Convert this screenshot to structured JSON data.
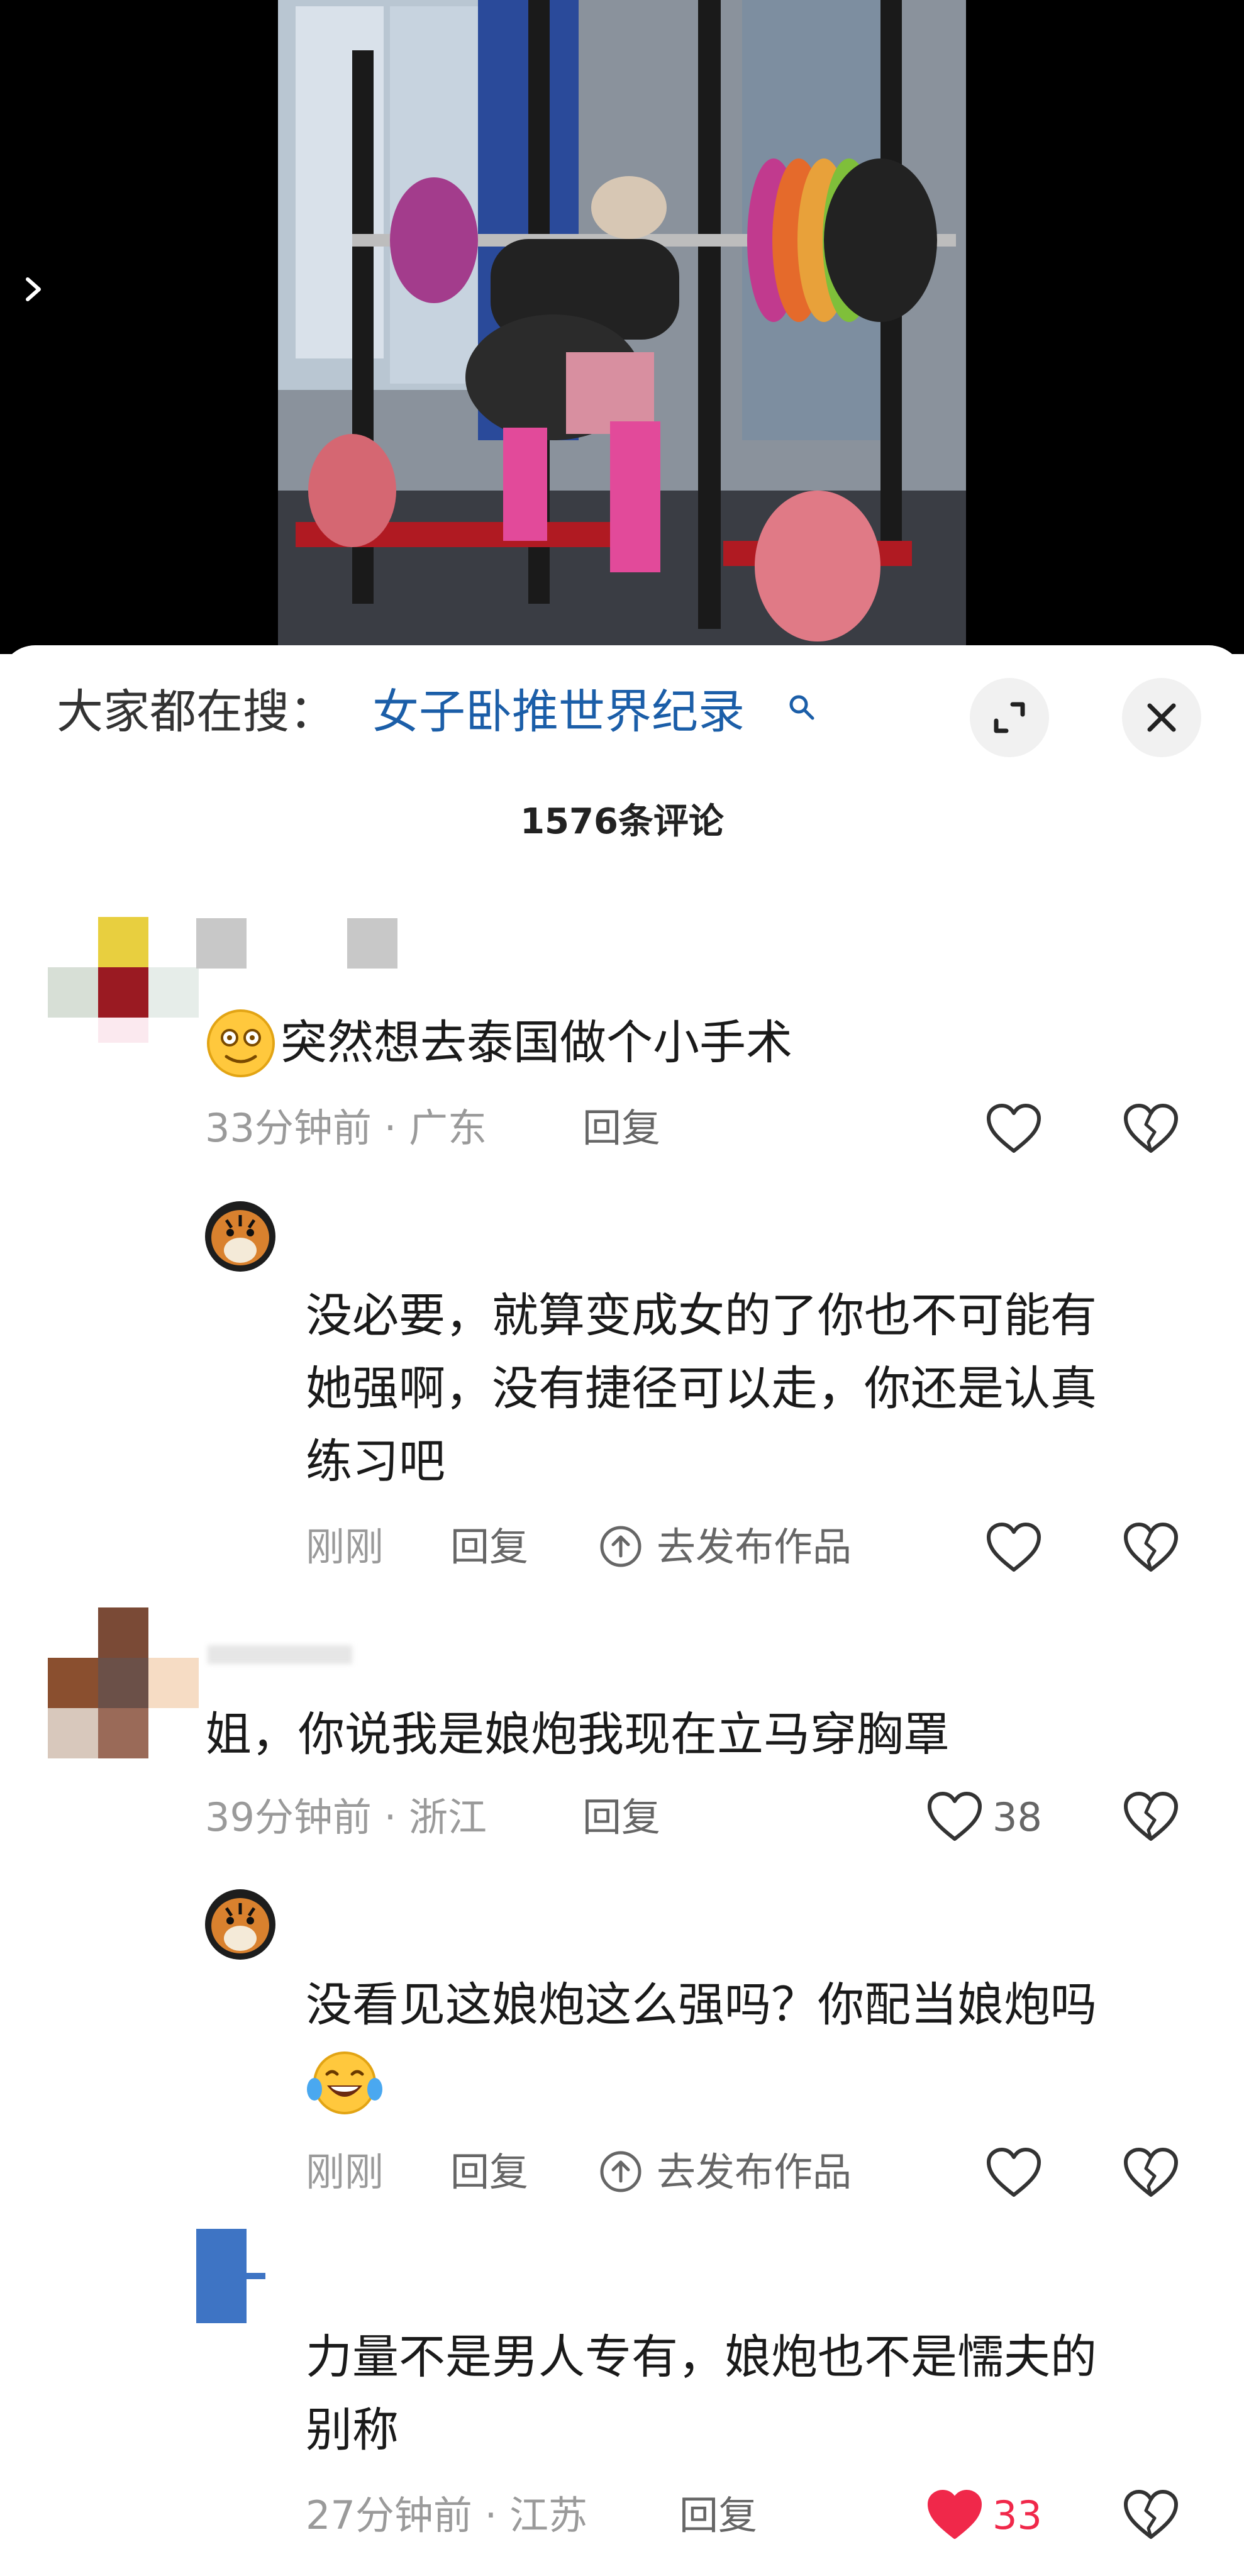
{
  "search_bar": {
    "prefix": "大家都在搜：",
    "term": "女子卧推世界纪录"
  },
  "comment_count_label": "1576条评论",
  "comments": [
    {
      "text": "突然想去泰国做个小手术",
      "meta": "33分钟前 · 广东",
      "reply_label": "回复",
      "like_count": "",
      "replies": [
        {
          "text_lines": [
            "没必要，就算变成女的了你也不可能有",
            "她强啊，没有捷径可以走，你还是认真",
            "练习吧"
          ],
          "time": "刚刚",
          "reply_label": "回复",
          "publish_label": "去发布作品"
        }
      ]
    },
    {
      "text": "姐，你说我是娘炮我现在立马穿胸罩",
      "meta": "39分钟前 · 浙江",
      "reply_label": "回复",
      "like_count": "38",
      "replies": [
        {
          "text_lines": [
            "没看见这娘炮这么强吗？你配当娘炮吗"
          ],
          "time": "刚刚",
          "reply_label": "回复",
          "publish_label": "去发布作品"
        }
      ]
    },
    {
      "text_lines": [
        "力量不是男人专有，娘炮也不是懦夫的",
        "别称"
      ],
      "meta": "27分钟前 · 江苏",
      "reply_label": "回复",
      "like_count": "33",
      "liked": true
    }
  ],
  "colors": {
    "search_term": "#1b5ea8",
    "liked_heart": "#f0284a",
    "meta_text": "#9a9a9a"
  }
}
